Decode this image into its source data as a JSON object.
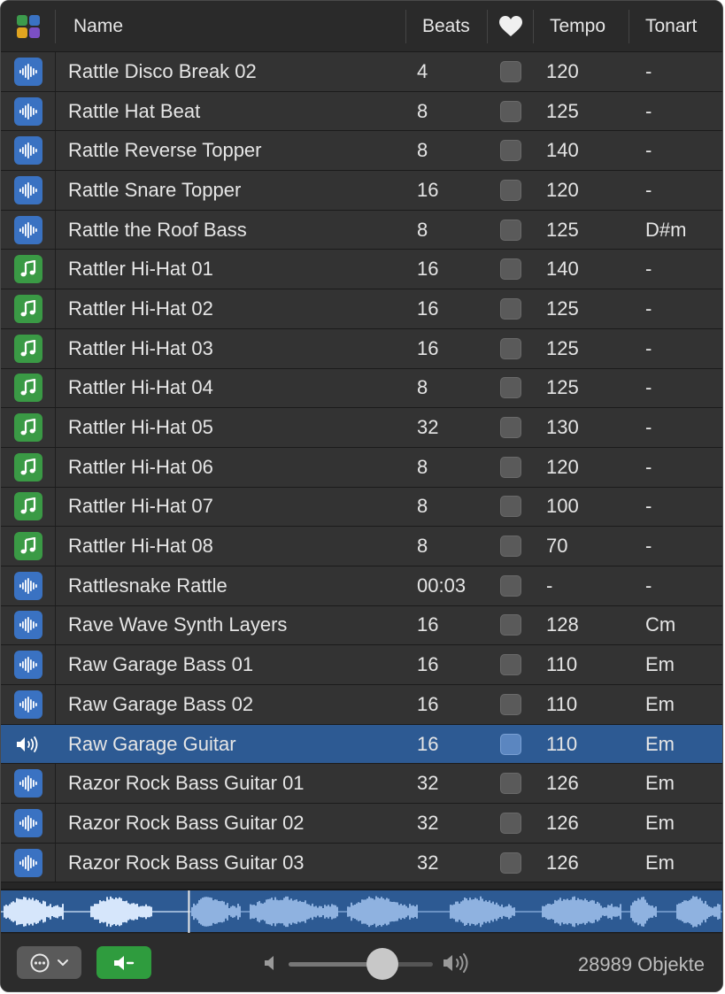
{
  "header": {
    "name": "Name",
    "beats": "Beats",
    "tempo": "Tempo",
    "key": "Tonart",
    "type_icon": "multicolor-grid-icon",
    "favorite_icon": "heart-icon"
  },
  "rows": [
    {
      "type": "audio",
      "name": "Rattle Disco Break 02",
      "beats": "4",
      "tempo": "120",
      "key": "-"
    },
    {
      "type": "audio",
      "name": "Rattle Hat Beat",
      "beats": "8",
      "tempo": "125",
      "key": "-"
    },
    {
      "type": "audio",
      "name": "Rattle Reverse Topper",
      "beats": "8",
      "tempo": "140",
      "key": "-"
    },
    {
      "type": "audio",
      "name": "Rattle Snare Topper",
      "beats": "16",
      "tempo": "120",
      "key": "-"
    },
    {
      "type": "audio",
      "name": "Rattle the Roof Bass",
      "beats": "8",
      "tempo": "125",
      "key": "D#m"
    },
    {
      "type": "midi",
      "name": "Rattler Hi-Hat 01",
      "beats": "16",
      "tempo": "140",
      "key": "-"
    },
    {
      "type": "midi",
      "name": "Rattler Hi-Hat 02",
      "beats": "16",
      "tempo": "125",
      "key": "-"
    },
    {
      "type": "midi",
      "name": "Rattler Hi-Hat 03",
      "beats": "16",
      "tempo": "125",
      "key": "-"
    },
    {
      "type": "midi",
      "name": "Rattler Hi-Hat 04",
      "beats": "8",
      "tempo": "125",
      "key": "-"
    },
    {
      "type": "midi",
      "name": "Rattler Hi-Hat 05",
      "beats": "32",
      "tempo": "130",
      "key": "-"
    },
    {
      "type": "midi",
      "name": "Rattler Hi-Hat 06",
      "beats": "8",
      "tempo": "120",
      "key": "-"
    },
    {
      "type": "midi",
      "name": "Rattler Hi-Hat 07",
      "beats": "8",
      "tempo": "100",
      "key": "-"
    },
    {
      "type": "midi",
      "name": "Rattler Hi-Hat 08",
      "beats": "8",
      "tempo": "70",
      "key": "-"
    },
    {
      "type": "audio",
      "name": "Rattlesnake Rattle",
      "beats": "00:03",
      "tempo": "-",
      "key": "-"
    },
    {
      "type": "audio",
      "name": "Rave Wave Synth Layers",
      "beats": "16",
      "tempo": "128",
      "key": "Cm"
    },
    {
      "type": "audio",
      "name": "Raw Garage Bass 01",
      "beats": "16",
      "tempo": "110",
      "key": "Em"
    },
    {
      "type": "audio",
      "name": "Raw Garage Bass 02",
      "beats": "16",
      "tempo": "110",
      "key": "Em"
    },
    {
      "type": "playing",
      "name": "Raw Garage Guitar",
      "beats": "16",
      "tempo": "110",
      "key": "Em",
      "selected": true
    },
    {
      "type": "audio",
      "name": "Razor Rock Bass Guitar 01",
      "beats": "32",
      "tempo": "126",
      "key": "Em"
    },
    {
      "type": "audio",
      "name": "Razor Rock Bass Guitar 02",
      "beats": "32",
      "tempo": "126",
      "key": "Em"
    },
    {
      "type": "audio",
      "name": "Razor Rock Bass Guitar 03",
      "beats": "32",
      "tempo": "126",
      "key": "Em"
    }
  ],
  "waveform": {
    "playhead_fraction": 0.26,
    "icon": "waveform-preview"
  },
  "footer": {
    "more_icon": "ellipsis-circle-icon",
    "more_chevron_icon": "chevron-down-icon",
    "preview_icon": "speaker-preview-icon",
    "volume_low_icon": "speaker-low-icon",
    "volume_high_icon": "speaker-high-icon",
    "volume_fraction": 0.65,
    "count_label": "28989 Objekte"
  },
  "colors": {
    "selection": "#2d5a93",
    "audio_icon": "#3a72c2",
    "midi_icon": "#3a9a45",
    "preview_button": "#2f9c3e"
  }
}
